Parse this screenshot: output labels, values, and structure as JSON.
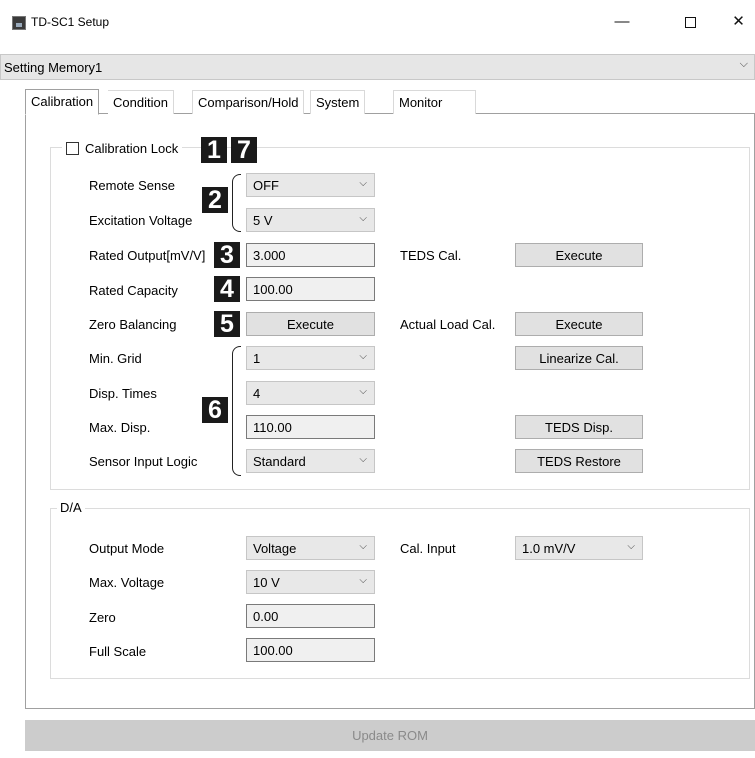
{
  "window": {
    "title": "TD-SC1 Setup",
    "minimize": "—",
    "close": "✕"
  },
  "memory": {
    "value": "Setting Memory1",
    "chevron": "⌵"
  },
  "tabs": [
    "Calibration",
    "Condition",
    "Comparison/Hold",
    "System",
    "Monitor"
  ],
  "calibration": {
    "lock_label": "Calibration Lock",
    "remote_sense": {
      "label": "Remote Sense",
      "value": "OFF"
    },
    "excitation_voltage": {
      "label": "Excitation Voltage",
      "value": "5 V"
    },
    "rated_output": {
      "label": "Rated Output[mV/V]",
      "value": "3.000"
    },
    "rated_capacity": {
      "label": "Rated Capacity",
      "value": "100.00"
    },
    "zero_balancing": {
      "label": "Zero Balancing",
      "button": "Execute"
    },
    "min_grid": {
      "label": "Min. Grid",
      "value": "1"
    },
    "disp_times": {
      "label": "Disp. Times",
      "value": "4"
    },
    "max_disp": {
      "label": "Max. Disp.",
      "value": "110.00"
    },
    "sensor_input_logic": {
      "label": "Sensor Input Logic",
      "value": "Standard"
    },
    "teds_cal": {
      "label": "TEDS Cal.",
      "button": "Execute"
    },
    "actual_load_cal": {
      "label": "Actual Load Cal.",
      "button": "Execute"
    },
    "linearize_button": "Linearize Cal.",
    "teds_disp_button": "TEDS Disp.",
    "teds_restore_button": "TEDS Restore"
  },
  "badges": [
    "1",
    "7",
    "2",
    "3",
    "4",
    "5",
    "6"
  ],
  "da": {
    "legend": "D/A",
    "output_mode": {
      "label": "Output Mode",
      "value": "Voltage"
    },
    "max_voltage": {
      "label": "Max. Voltage",
      "value": "10 V"
    },
    "zero": {
      "label": "Zero",
      "value": "0.00"
    },
    "full_scale": {
      "label": "Full Scale",
      "value": "100.00"
    },
    "cal_input": {
      "label": "Cal. Input",
      "value": "1.0 mV/V"
    }
  },
  "footer": {
    "update_rom": "Update ROM"
  },
  "colors": {
    "badge": "#1a1a1a",
    "disabled_bar": "#cccccc",
    "field_bg": "#f0f0f0"
  }
}
